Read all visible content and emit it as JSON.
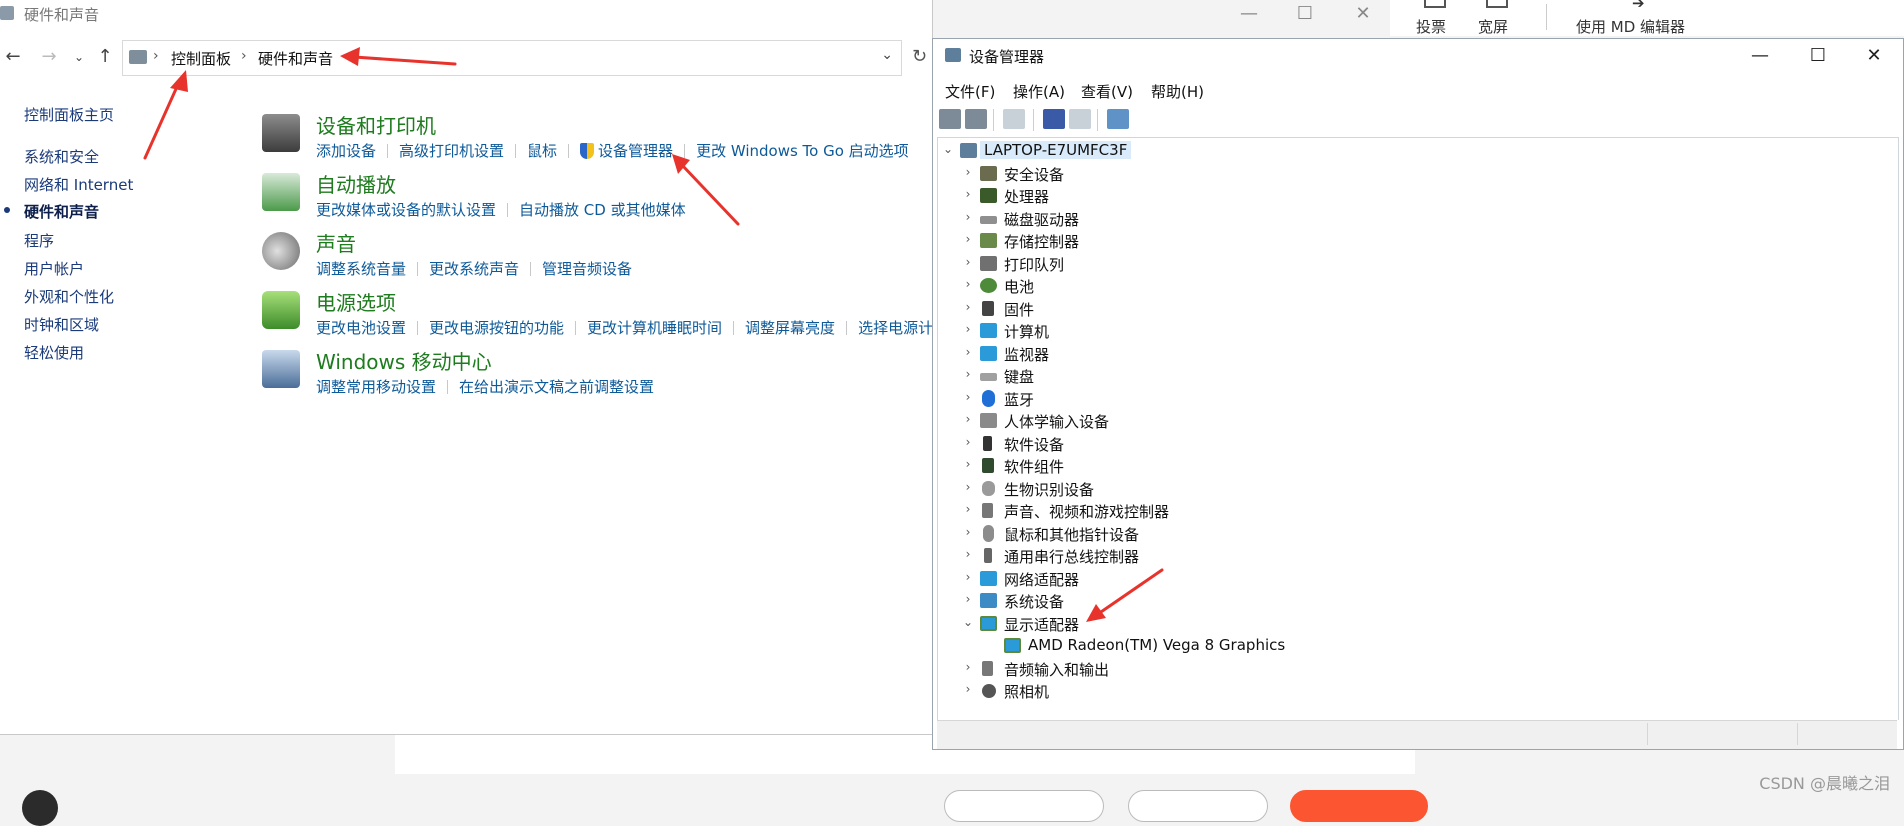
{
  "background": {
    "toolbar": {
      "vote": "投票",
      "wide": "宽屏",
      "md_editor": "使用 MD 编辑器"
    },
    "watermark": "CSDN @晨曦之泪"
  },
  "control_panel": {
    "title": "硬件和声音",
    "breadcrumb": [
      "控制面板",
      "硬件和声音"
    ],
    "sidebar": [
      {
        "label": "控制面板主页",
        "active": false
      },
      {
        "label": "系统和安全",
        "active": false
      },
      {
        "label": "网络和 Internet",
        "active": false
      },
      {
        "label": "硬件和声音",
        "active": true
      },
      {
        "label": "程序",
        "active": false
      },
      {
        "label": "用户帐户",
        "active": false
      },
      {
        "label": "外观和个性化",
        "active": false
      },
      {
        "label": "时钟和区域",
        "active": false
      },
      {
        "label": "轻松使用",
        "active": false
      }
    ],
    "categories": [
      {
        "title": "设备和打印机",
        "links": [
          "添加设备",
          "高级打印机设置",
          "鼠标",
          "设备管理器",
          "更改 Windows To Go 启动选项"
        ]
      },
      {
        "title": "自动播放",
        "links": [
          "更改媒体或设备的默认设置",
          "自动播放 CD 或其他媒体"
        ]
      },
      {
        "title": "声音",
        "links": [
          "调整系统音量",
          "更改系统声音",
          "管理音频设备"
        ]
      },
      {
        "title": "电源选项",
        "links": [
          "更改电池设置",
          "更改电源按钮的功能",
          "更改计算机睡眠时间",
          "调整屏幕亮度",
          "选择电源计"
        ]
      },
      {
        "title": "Windows 移动中心",
        "links": [
          "调整常用移动设置",
          "在给出演示文稿之前调整设置"
        ]
      }
    ]
  },
  "device_manager": {
    "title": "设备管理器",
    "menu": [
      "文件(F)",
      "操作(A)",
      "查看(V)",
      "帮助(H)"
    ],
    "root": "LAPTOP-E7UMFC3F",
    "items": [
      "安全设备",
      "处理器",
      "磁盘驱动器",
      "存储控制器",
      "打印队列",
      "电池",
      "固件",
      "计算机",
      "监视器",
      "键盘",
      "蓝牙",
      "人体学输入设备",
      "软件设备",
      "软件组件",
      "生物识别设备",
      "声音、视频和游戏控制器",
      "鼠标和其他指针设备",
      "通用串行总线控制器",
      "网络适配器",
      "系统设备",
      "显示适配器",
      "AMD Radeon(TM) Vega 8 Graphics",
      "音频输入和输出",
      "照相机"
    ]
  },
  "colors": {
    "link": "#0e5a99",
    "category_title": "#1e7b1e",
    "annotation": "#e8332d",
    "selection": "#d9ebfb"
  }
}
